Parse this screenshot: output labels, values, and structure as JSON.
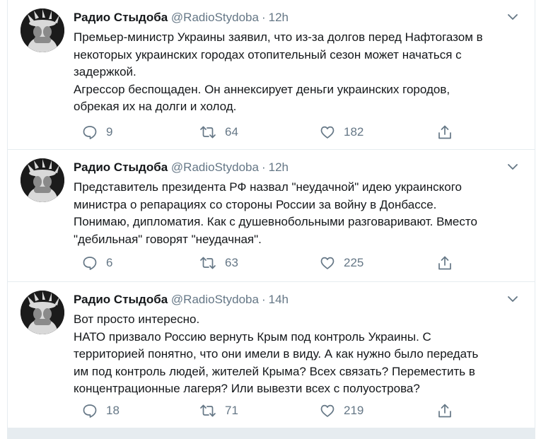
{
  "account": {
    "name": "Радио Стыдоба",
    "handle": "@RadioStydoba"
  },
  "tweets": [
    {
      "time": "12h",
      "lines": [
        "Премьер-министр Украины заявил, что из-за долгов перед Нафтогазом в",
        "некоторых украинских городах отопительный сезон может начаться с",
        "задержкой.",
        "Агрессор беспощаден. Он аннексирует деньги украинских городов,",
        "обрекая их на долги и холод."
      ],
      "replies": "9",
      "retweets": "64",
      "likes": "182"
    },
    {
      "time": "12h",
      "lines": [
        "Представитель президента РФ назвал \"неудачной\" идею украинского",
        "министра о репарациях со стороны России за войну в Донбассе.",
        "Понимаю, дипломатия. Как с душевнобольными разговаривают. Вместо",
        "\"дебильная\" говорят \"неудачная\"."
      ],
      "replies": "6",
      "retweets": "63",
      "likes": "225"
    },
    {
      "time": "14h",
      "lines": [
        "Вот просто интересно.",
        "НАТО призвало Россию вернуть Крым под контроль Украины. С",
        "территорией понятно, что они имели в виду. А как нужно было передать",
        "им под контроль людей, жителей Крыма? Всех связать? Переместить в",
        "концентрационные лагеря? Или вывезти всех с полуострова?"
      ],
      "replies": "18",
      "retweets": "71",
      "likes": "219"
    }
  ],
  "icons": {
    "reply": "reply-icon",
    "retweet": "retweet-icon",
    "like": "heart-icon",
    "share": "share-icon",
    "more": "chevron-down-icon"
  },
  "colors": {
    "text": "#14171a",
    "secondary": "#657786",
    "divider": "#e6ecf0"
  }
}
